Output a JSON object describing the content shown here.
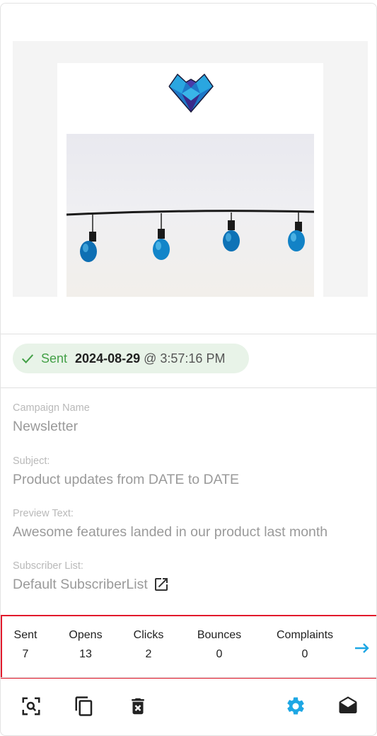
{
  "status": {
    "label": "Sent",
    "date": "2024-08-29",
    "at": "@",
    "time": "3:57:16 PM"
  },
  "fields": [
    {
      "label": "Campaign Name",
      "value": "Newsletter"
    },
    {
      "label": "Subject:",
      "value": "Product updates from DATE to DATE"
    },
    {
      "label": "Preview Text:",
      "value": "Awesome features landed in our product last month"
    },
    {
      "label": "Subscriber List:",
      "value": "Default SubscriberList"
    }
  ],
  "stats": [
    {
      "label": "Sent",
      "value": "7"
    },
    {
      "label": "Opens",
      "value": "13"
    },
    {
      "label": "Clicks",
      "value": "2"
    },
    {
      "label": "Bounces",
      "value": "0"
    },
    {
      "label": "Complaints",
      "value": "0"
    }
  ],
  "icons": {
    "status": "check-icon",
    "subscriber_list": "open-in-new-icon",
    "stats_more": "arrow-right-icon",
    "actions": [
      "preview-search-icon",
      "copy-icon",
      "delete-icon",
      "settings-icon",
      "mail-open-icon"
    ]
  },
  "colors": {
    "accent": "#1ea7e4",
    "sent_green": "#43a047",
    "highlight_red": "#e21a2c"
  }
}
